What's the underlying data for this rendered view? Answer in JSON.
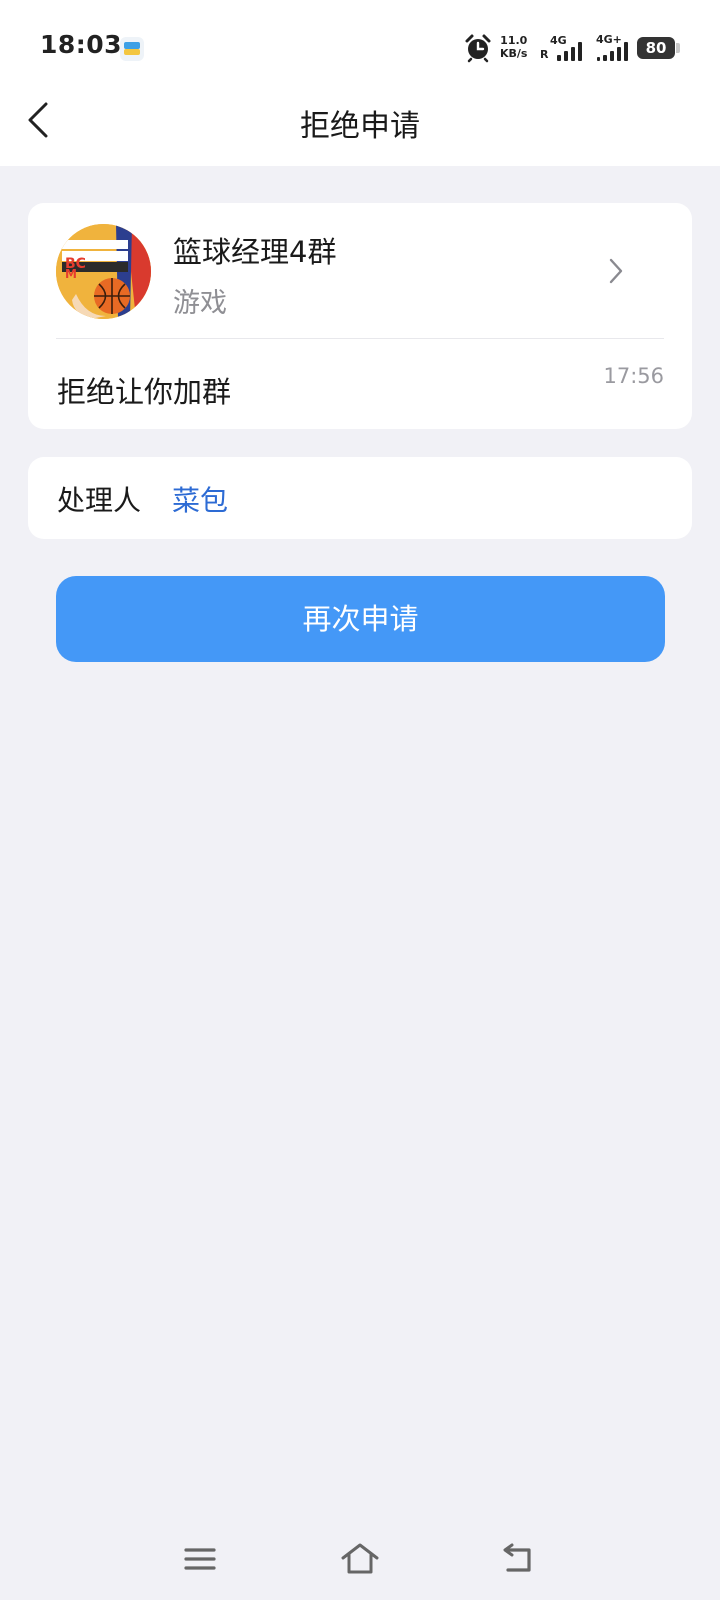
{
  "status_bar": {
    "time": "18:03",
    "net_speed_value": "11.0",
    "net_speed_unit": "KB/s",
    "sim1_tag": "4G",
    "sim1_roaming": "R",
    "sim2_tag": "4G+",
    "battery": "80",
    "icons": [
      "notification-app-icon",
      "alarm-clock-icon",
      "signal-icon",
      "battery-icon"
    ]
  },
  "header": {
    "title": "拒绝申请",
    "back_icon": "chevron-left-icon"
  },
  "group_card": {
    "name": "篮球经理4群",
    "category": "游戏",
    "avatar_icon": "basketball-manager-group-avatar",
    "message": "拒绝让你加群",
    "time": "17:56"
  },
  "handler_card": {
    "label": "处理人",
    "name": "菜包"
  },
  "actions": {
    "reapply_label": "再次申请"
  },
  "nav_bar": {
    "icons": [
      "menu-icon",
      "home-icon",
      "back-icon"
    ]
  },
  "colors": {
    "page_background": "#f1f1f6",
    "accent_button": "#4498f7",
    "link_blue": "#2d6bd4",
    "secondary_text": "#8f8f94"
  }
}
